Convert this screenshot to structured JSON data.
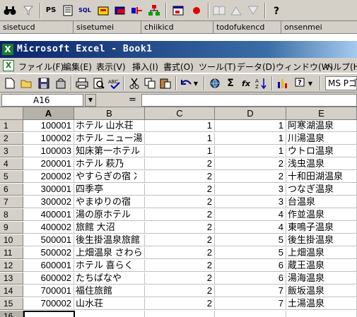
{
  "ext_toolbar": {
    "ps_label": "PS",
    "sql_label": "SQL"
  },
  "field_row": {
    "fields": [
      "sisetucd",
      "sisetumei",
      "chiikicd",
      "todofukencd",
      "onsenmei"
    ]
  },
  "window": {
    "title": "Microsoft Excel - Book1",
    "app_icon": "X"
  },
  "menu": {
    "items": [
      "ファイル(F)",
      "編集(E)",
      "表示(V)",
      "挿入(I)",
      "書式(O)",
      "ツール(T)",
      "データ(D)",
      "ウィンドウ(W)",
      "ヘルプ(H)"
    ]
  },
  "toolbar": {
    "font_name": "MS Pゴシック",
    "sigma": "Σ",
    "fx": "fx"
  },
  "formula_bar": {
    "name_box": "A16",
    "equals": "=",
    "formula": ""
  },
  "grid": {
    "columns": [
      "A",
      "B",
      "C",
      "D",
      "E"
    ],
    "active_column": "A",
    "rows": [
      {
        "n": "1",
        "a": "100001",
        "b": "ホテル 山水荘",
        "c": "1",
        "d": "1",
        "e": "阿寒湖温泉"
      },
      {
        "n": "2",
        "a": "100002",
        "b": "ホテル ニュー湯",
        "c": "1",
        "d": "1",
        "e": "川湯温泉"
      },
      {
        "n": "3",
        "a": "100003",
        "b": "知床第一ホテル",
        "c": "1",
        "d": "1",
        "e": "ウトロ温泉"
      },
      {
        "n": "4",
        "a": "200001",
        "b": "ホテル 萩乃",
        "c": "2",
        "d": "2",
        "e": "浅虫温泉"
      },
      {
        "n": "5",
        "a": "200002",
        "b": "やすらぎの宿 冫",
        "c": "2",
        "d": "2",
        "e": "十和田湖温泉"
      },
      {
        "n": "6",
        "a": "300001",
        "b": "四季亭",
        "c": "2",
        "d": "3",
        "e": "つなぎ温泉"
      },
      {
        "n": "7",
        "a": "300002",
        "b": "やまゆりの宿",
        "c": "2",
        "d": "3",
        "e": "台温泉"
      },
      {
        "n": "8",
        "a": "400001",
        "b": "湯の原ホテル",
        "c": "2",
        "d": "4",
        "e": "作並温泉"
      },
      {
        "n": "9",
        "a": "400002",
        "b": "旅館 大沼",
        "c": "2",
        "d": "4",
        "e": "東鳴子温泉"
      },
      {
        "n": "10",
        "a": "500001",
        "b": "後生掛温泉旅館",
        "c": "2",
        "d": "5",
        "e": "後生掛温泉"
      },
      {
        "n": "11",
        "a": "500002",
        "b": "上畑温泉 さわら",
        "c": "2",
        "d": "5",
        "e": "上畑温泉"
      },
      {
        "n": "12",
        "a": "600001",
        "b": "ホテル 喜らく",
        "c": "2",
        "d": "6",
        "e": "蔵王温泉"
      },
      {
        "n": "13",
        "a": "600002",
        "b": "たちばなや",
        "c": "2",
        "d": "6",
        "e": "湯海温泉"
      },
      {
        "n": "14",
        "a": "700001",
        "b": "福住旅館",
        "c": "2",
        "d": "7",
        "e": "飯坂温泉"
      },
      {
        "n": "15",
        "a": "700002",
        "b": "山水荘",
        "c": "2",
        "d": "7",
        "e": "土湯温泉"
      }
    ],
    "next_row_number": "16"
  }
}
